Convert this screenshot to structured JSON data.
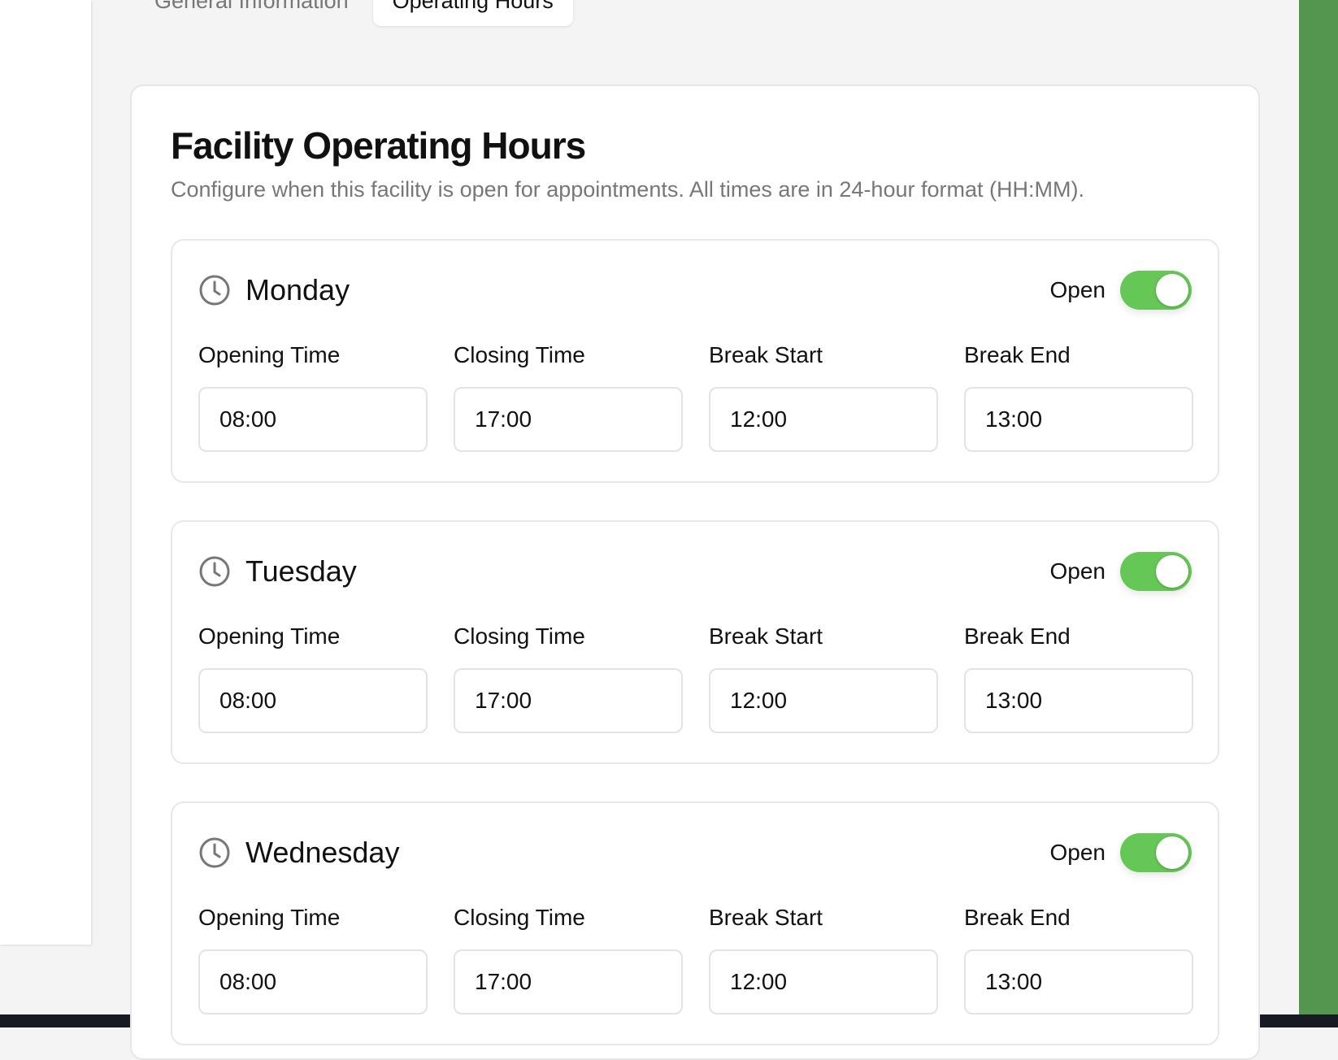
{
  "tabs": {
    "general": "General Information",
    "hours": "Operating Hours"
  },
  "card": {
    "title": "Facility Operating Hours",
    "description": "Configure when this facility is open for appointments. All times are in 24-hour format (HH:MM)."
  },
  "days": [
    {
      "name": "Monday",
      "status_label": "Open",
      "is_open": true,
      "fields": [
        {
          "label": "Opening Time",
          "value": "08:00"
        },
        {
          "label": "Closing Time",
          "value": "17:00"
        },
        {
          "label": "Break Start",
          "value": "12:00"
        },
        {
          "label": "Break End",
          "value": "13:00"
        }
      ]
    },
    {
      "name": "Tuesday",
      "status_label": "Open",
      "is_open": true,
      "fields": [
        {
          "label": "Opening Time",
          "value": "08:00"
        },
        {
          "label": "Closing Time",
          "value": "17:00"
        },
        {
          "label": "Break Start",
          "value": "12:00"
        },
        {
          "label": "Break End",
          "value": "13:00"
        }
      ]
    },
    {
      "name": "Wednesday",
      "status_label": "Open",
      "is_open": true,
      "fields": [
        {
          "label": "Opening Time",
          "value": "08:00"
        },
        {
          "label": "Closing Time",
          "value": "17:00"
        },
        {
          "label": "Break Start",
          "value": "12:00"
        },
        {
          "label": "Break End",
          "value": "13:00"
        }
      ]
    }
  ],
  "colors": {
    "toggle_on": "#65c755",
    "accent_bar": "#54954f",
    "muted_text": "#777777"
  },
  "icons": {
    "day_icon": "clock-icon"
  }
}
